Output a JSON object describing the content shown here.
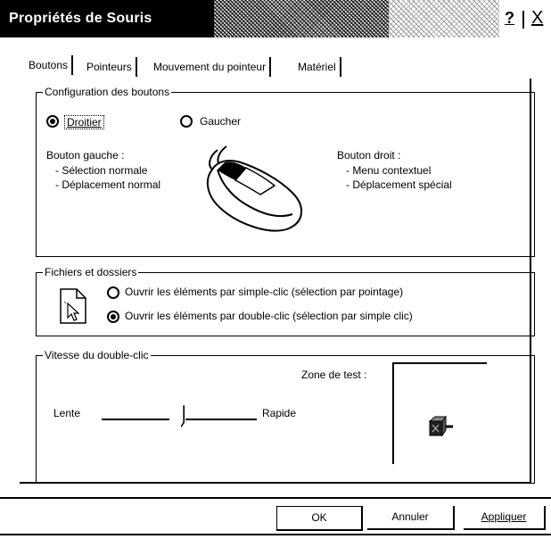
{
  "window": {
    "title": "Propriétés de Souris",
    "help_label": "?",
    "close_label": "X"
  },
  "tabs": [
    {
      "label": "Boutons",
      "active": true
    },
    {
      "label": "Pointeurs",
      "active": false
    },
    {
      "label": "Mouvement du pointeur",
      "active": false
    },
    {
      "label": "Matériel",
      "active": false
    }
  ],
  "buttons_config": {
    "legend": "Configuration des boutons",
    "right_handed": {
      "label": "Droitier",
      "selected": true
    },
    "left_handed": {
      "label": "Gaucher",
      "selected": false
    },
    "left_button": {
      "title": "Bouton gauche :",
      "lines": [
        "- Sélection normale",
        "- Déplacement normal"
      ]
    },
    "right_button": {
      "title": "Bouton droit :",
      "lines": [
        "- Menu contextuel",
        "- Déplacement spécial"
      ]
    }
  },
  "files_folders": {
    "legend": "Fichiers et dossiers",
    "single_click": {
      "label": "Ouvrir les éléments par simple-clic (sélection par pointage)",
      "selected": false
    },
    "double_click": {
      "label": "Ouvrir les éléments par double-clic (sélection par simple clic)",
      "selected": true
    }
  },
  "double_click_speed": {
    "legend": "Vitesse du double-clic",
    "slow_label": "Lente",
    "fast_label": "Rapide",
    "test_zone_label": "Zone de test :",
    "speed_fraction": 0.5
  },
  "dialog_buttons": {
    "ok": "OK",
    "cancel": "Annuler",
    "apply": "Appliquer"
  }
}
